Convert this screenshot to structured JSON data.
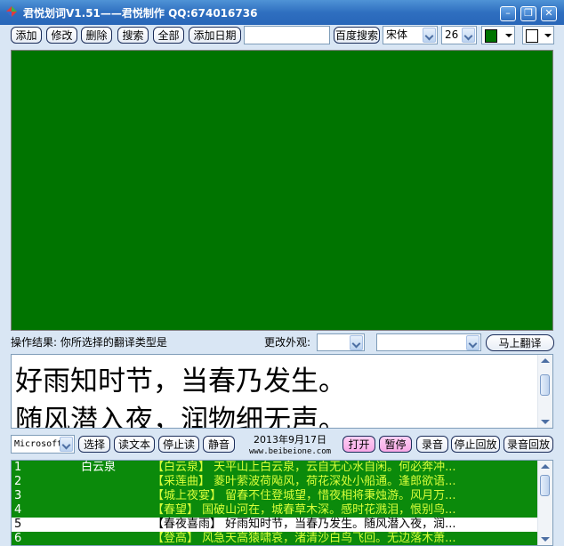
{
  "window": {
    "title": "君悦划词V1.51——君悦制作 QQ:674016736"
  },
  "toolbar": {
    "add": "添加",
    "edit": "修改",
    "delete": "删除",
    "search": "搜索",
    "all": "全部",
    "add_date": "添加日期",
    "search_input": "",
    "baidu_search": "百度搜索",
    "font_name": "宋体",
    "font_size": "26",
    "fg_color": "#007400",
    "bg_color": "#ffffff"
  },
  "canvas": {
    "color": "#007400"
  },
  "status": {
    "result_text": "操作结果: 你所选择的翻译类型是",
    "change_look": "更改外观:",
    "look_value": "",
    "translate_type_value": "",
    "translate_button": "马上翻译"
  },
  "poem": {
    "line1": "好雨知时节，当春乃发生。",
    "line2": "随风潜入夜，润物细无声。"
  },
  "bottom": {
    "voice": "Microsoft",
    "select": "选择",
    "read_text": "读文本",
    "stop_read": "停止读",
    "mute": "静音",
    "date": "2013年9月17日",
    "site": "www.beibeione.com",
    "open": "打开",
    "pause": "暂停",
    "record": "录音",
    "stop_playback": "停止回放",
    "record_playback": "录音回放"
  },
  "list": {
    "rows": [
      {
        "num": "1",
        "name": "白云泉",
        "text": "【白云泉】 天平山上白云泉，云自无心水自闲。何必奔冲...",
        "style": "green"
      },
      {
        "num": "2",
        "name": "",
        "text": "【采莲曲】 菱叶萦波荷飐风，荷花深处小船通。逢郎欲语...",
        "style": "green"
      },
      {
        "num": "3",
        "name": "",
        "text": "【城上夜宴】 留春不住登城望，惜夜相将秉烛游。风月万...",
        "style": "green"
      },
      {
        "num": "4",
        "name": "",
        "text": "【春望】 国破山河在，城春草木深。感时花溅泪，恨别鸟...",
        "style": "green"
      },
      {
        "num": "5",
        "name": "",
        "text": "【春夜喜雨】 好雨知时节，当春乃发生。随风潜入夜，润...",
        "style": "white"
      },
      {
        "num": "6",
        "name": "",
        "text": "【登高】 风急天高猿啸哀，渚清沙白鸟飞回。无边落木萧...",
        "style": "green"
      }
    ]
  }
}
